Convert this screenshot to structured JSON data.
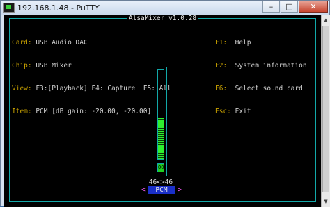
{
  "window": {
    "title": "192.168.1.48 - PuTTY",
    "minimize_label": "–",
    "maximize_label": "□",
    "close_label": "✕"
  },
  "mixer": {
    "title": "AlsaMixer v1.0.28",
    "info": [
      {
        "label": "Card:",
        "value": " USB Audio DAC"
      },
      {
        "label": "Chip:",
        "value": " USB Mixer"
      },
      {
        "label": "View:",
        "value": " F3:[Playback] F4: Capture  F5: All"
      },
      {
        "label": "Item:",
        "value": " PCM [dB gain: -20.00, -20.00]"
      }
    ],
    "keys": [
      {
        "key": "F1:",
        "desc": "  Help"
      },
      {
        "key": "F2:",
        "desc": "  System information"
      },
      {
        "key": "F6:",
        "desc": "  Select sound card"
      },
      {
        "key": "Esc:",
        "desc": " Exit"
      }
    ],
    "control": {
      "name": "PCM",
      "level_text": "46<>46",
      "mute_text": "OO",
      "level_fraction": 0.46,
      "left_arrow": "<",
      "right_arrow": ">"
    }
  },
  "colors": {
    "frame": "#12a8a8",
    "meter": "#2ef02e",
    "label": "#c8a100",
    "channel_bg": "#1a2fc8",
    "arrow": "#ff5fff"
  }
}
